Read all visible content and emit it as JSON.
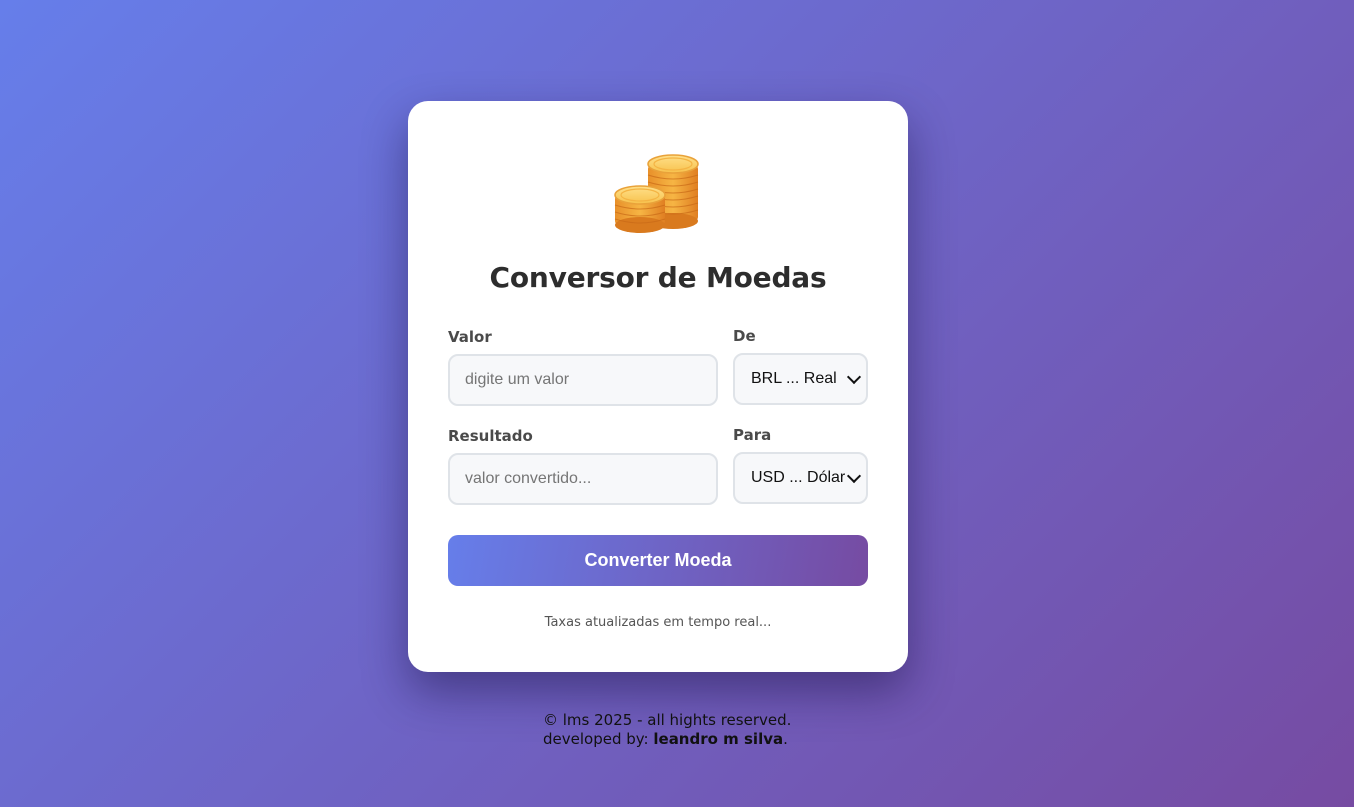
{
  "card": {
    "icon": "coins-icon",
    "title": "Conversor de Moedas",
    "value_label": "Valor",
    "value_placeholder": "digite um valor",
    "from_label": "De",
    "from_selected": "BRL ... Real",
    "result_label": "Resultado",
    "result_placeholder": "valor convertido...",
    "to_label": "Para",
    "to_selected": "USD ... Dólar",
    "convert_button": "Converter Moeda",
    "note": "Taxas atualizadas em tempo real..."
  },
  "footer": {
    "line1": "© lms 2025 - all hights reserved.",
    "line2_prefix": "developed by: ",
    "author": "leandro m silva",
    "line2_suffix": "."
  },
  "colors": {
    "gradient_start": "#667eea",
    "gradient_end": "#764ba2"
  }
}
